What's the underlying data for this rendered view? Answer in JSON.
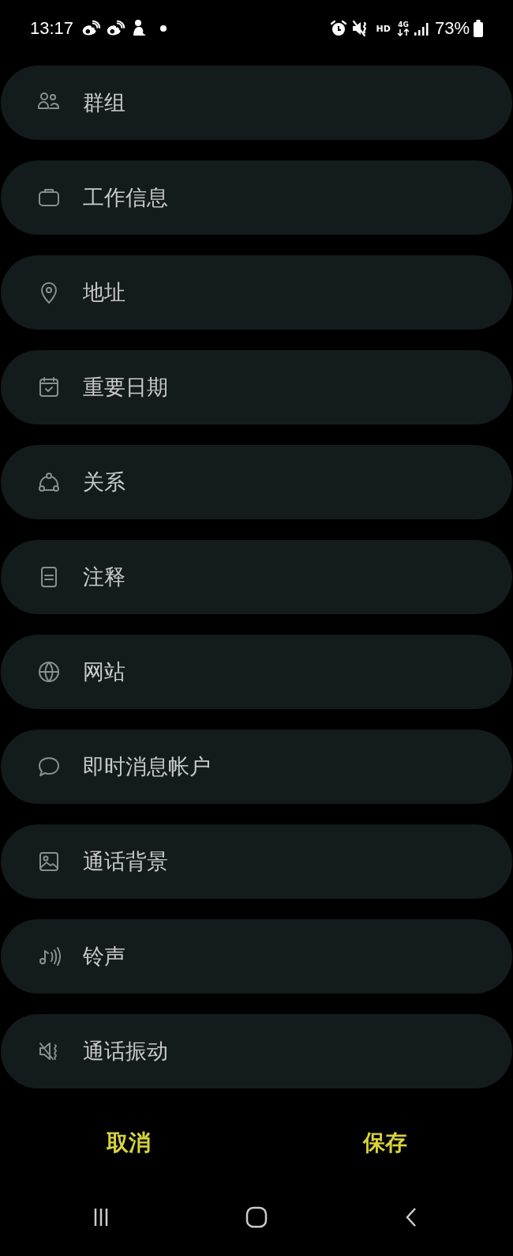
{
  "status_bar": {
    "time": "13:17",
    "hd": "HD",
    "network": "4G",
    "battery": "73%"
  },
  "fields": [
    {
      "label": "群组"
    },
    {
      "label": "工作信息"
    },
    {
      "label": "地址"
    },
    {
      "label": "重要日期"
    },
    {
      "label": "关系"
    },
    {
      "label": "注释"
    },
    {
      "label": "网站"
    },
    {
      "label": "即时消息帐户"
    },
    {
      "label": "通话背景"
    },
    {
      "label": "铃声"
    },
    {
      "label": "通话振动"
    }
  ],
  "buttons": [
    {
      "label": "取消"
    },
    {
      "label": "保存"
    }
  ]
}
